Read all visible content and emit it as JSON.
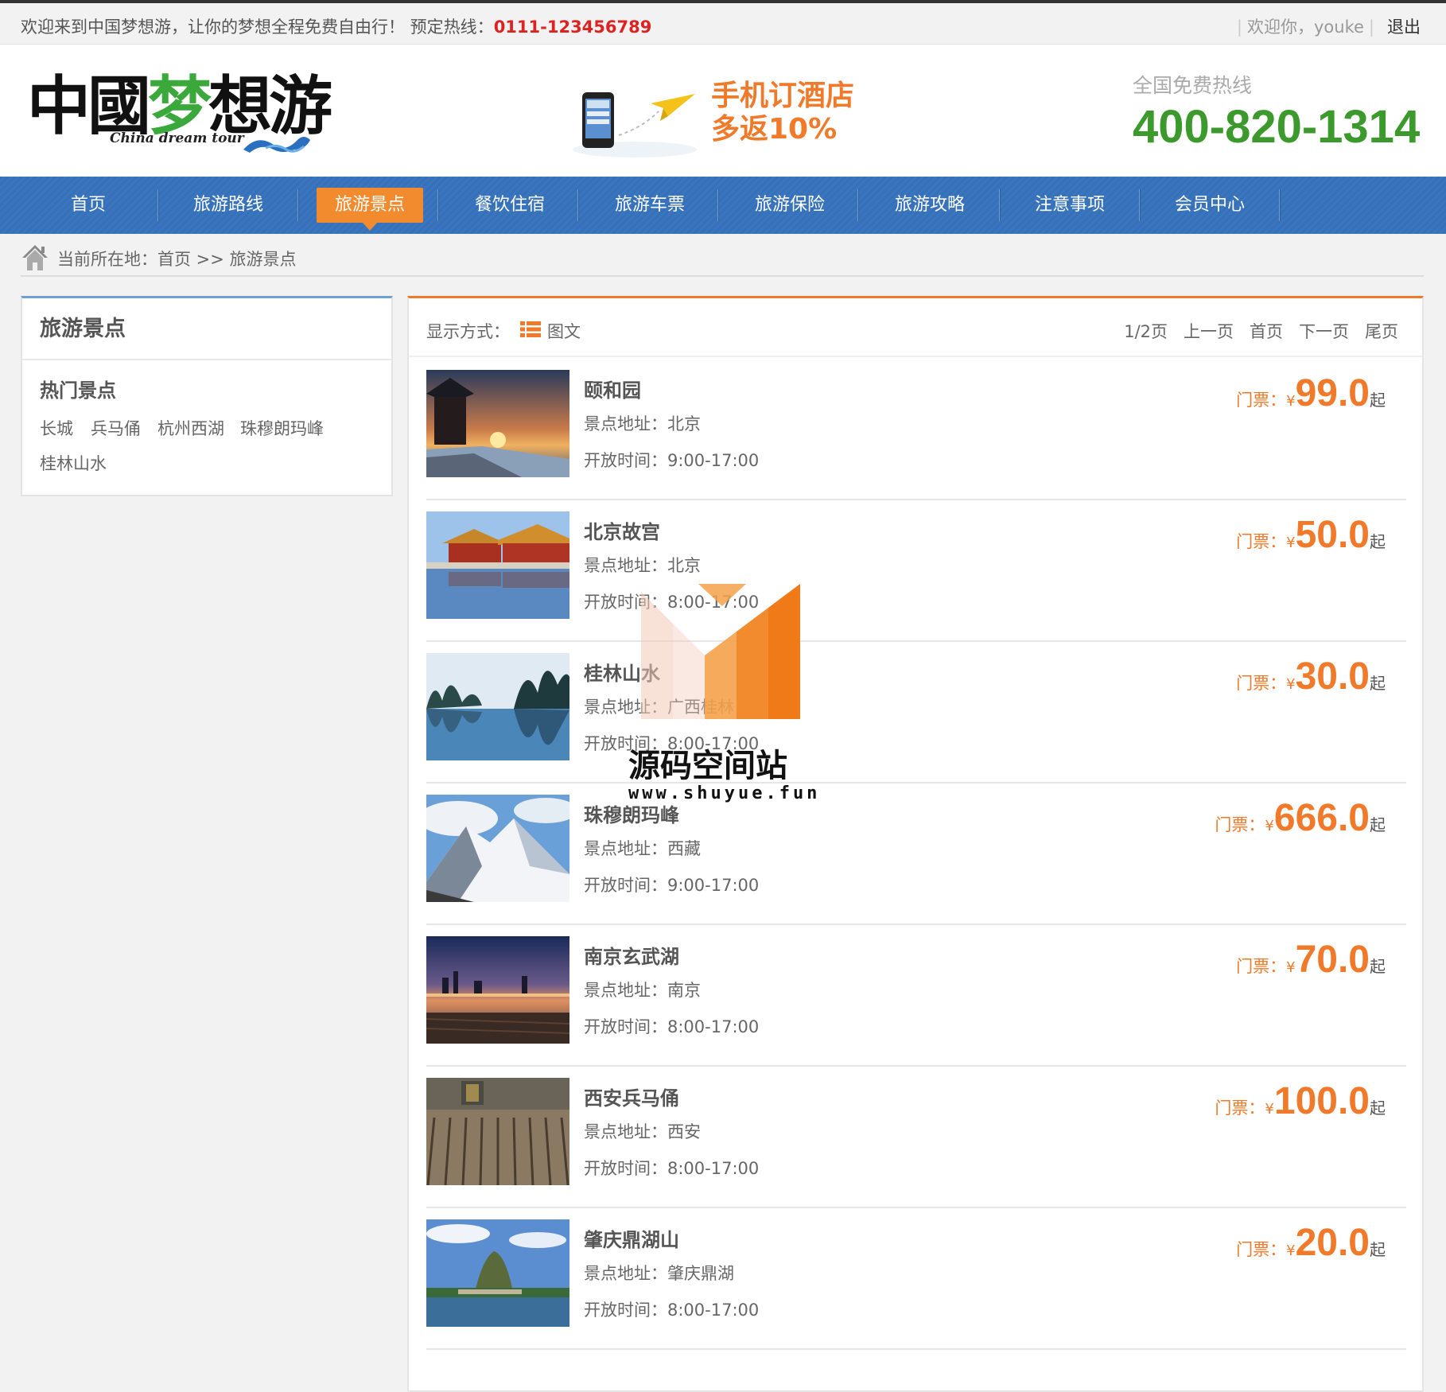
{
  "topbar": {
    "welcome": "欢迎来到中国梦想游，让你的梦想全程免费自由行！ 预定热线：",
    "hotline": "0111-123456789",
    "user": "欢迎你，youke",
    "logout": "退出"
  },
  "header": {
    "logo_cn": "中國梦想游",
    "logo_en": "China dream tour",
    "promo_line1": "手机订酒店",
    "promo_line2": "多返10%",
    "free_hotline_label": "全国免费热线",
    "free_hotline": "400-820-1314"
  },
  "nav": {
    "items": [
      {
        "label": "首页"
      },
      {
        "label": "旅游路线"
      },
      {
        "label": "旅游景点",
        "active": true
      },
      {
        "label": "餐饮住宿"
      },
      {
        "label": "旅游车票"
      },
      {
        "label": "旅游保险"
      },
      {
        "label": "旅游攻略"
      },
      {
        "label": "注意事项"
      },
      {
        "label": "会员中心"
      }
    ]
  },
  "breadcrumb": {
    "text": "当前所在地：首页 >> 旅游景点"
  },
  "sidebar": {
    "title": "旅游景点",
    "subtitle": "热门景点",
    "links": [
      "长城",
      "兵马俑",
      "杭州西湖",
      "珠穆朗玛峰",
      "桂林山水"
    ]
  },
  "toolbar": {
    "display_label": "显示方式：",
    "display_mode": "图文",
    "page_info": "1/2页",
    "prev": "上一页",
    "first": "首页",
    "next": "下一页",
    "last": "尾页"
  },
  "price_label": "门票：",
  "currency": "¥",
  "price_suffix": "起",
  "items": [
    {
      "name": "颐和园",
      "address": "景点地址：北京",
      "hours": "开放时间：9:00-17:00",
      "price": "99.0",
      "img": "sunset-palace"
    },
    {
      "name": "北京故宫",
      "address": "景点地址：北京",
      "hours": "开放时间：8:00-17:00",
      "price": "50.0",
      "img": "forbidden-city"
    },
    {
      "name": "桂林山水",
      "address": "景点地址：广西桂林",
      "hours": "开放时间：8:00-17:00",
      "price": "30.0",
      "img": "karst-river"
    },
    {
      "name": "珠穆朗玛峰",
      "address": "景点地址：西藏",
      "hours": "开放时间：9:00-17:00",
      "price": "666.0",
      "img": "snow-mountain"
    },
    {
      "name": "南京玄武湖",
      "address": "景点地址：南京",
      "hours": "开放时间：8:00-17:00",
      "price": "70.0",
      "img": "lake-skyline"
    },
    {
      "name": "西安兵马俑",
      "address": "景点地址：西安",
      "hours": "开放时间：8:00-17:00",
      "price": "100.0",
      "img": "terracotta-army"
    },
    {
      "name": "肇庆鼎湖山",
      "address": "景点地址：肇庆鼎湖",
      "hours": "开放时间：8:00-17:00",
      "price": "20.0",
      "img": "green-hill-lake"
    }
  ],
  "watermark": {
    "title": "源码空间站",
    "url": "www.shuyue.fun"
  },
  "colors": {
    "accent_orange": "#f07a2a",
    "nav_blue": "#3670b8",
    "hotline_green": "#3c9a2c",
    "hotline_red": "#dd2222"
  }
}
